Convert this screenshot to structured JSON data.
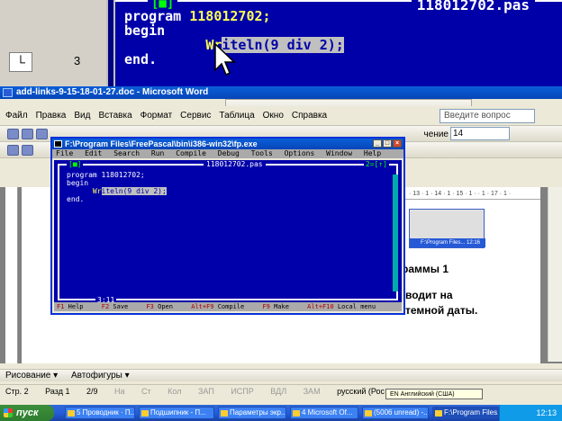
{
  "zoom": {
    "bracket": "[■]",
    "filename": "118012702.pas",
    "ruler_num": "3",
    "line1_kw": "program ",
    "line1_id": "118012702;",
    "line2": "begin",
    "line3_pre": "Wr",
    "line3_sel": "iteln(9 div 2);",
    "line4": "end."
  },
  "word": {
    "title": "add-links-9-15-18-01-27.doc - Microsoft Word",
    "menu": [
      "Файл",
      "Правка",
      "Вид",
      "Вставка",
      "Формат",
      "Сервис",
      "Таблица",
      "Окно",
      "Справка"
    ],
    "help_placeholder": "Введите вопрос",
    "zoom_value": "14",
    "style_label": "чение",
    "ruler": "· 13 · 1 · 14 · 1 · 15 · 1 ·  · 1 · 17 · 1 ·",
    "text1": "раммы 1",
    "text2": "водит на",
    "text3": "темной даты.",
    "mini_task": "F:\\Program Files...  12:16",
    "draw": {
      "draw_label": "Рисование ▾",
      "autoshapes": "Автофигуры ▾"
    },
    "status": {
      "page": "Стр. 2",
      "section": "Разд 1",
      "pages": "2/9",
      "at": "На",
      "line": "Ст",
      "col": "Кол",
      "rec": "ЗАП",
      "trk": "ИСПР",
      "ext": "ВДЛ",
      "ovr": "ЗАМ",
      "lang": "русский (Рос",
      "lang_popup": "EN Английский (США)"
    }
  },
  "fp": {
    "title": "F:\\Program Files\\FreePascal\\bin\\i386-win32\\fp.exe",
    "menu": [
      "File",
      "Edit",
      "Search",
      "Run",
      "Compile",
      "Debug",
      "Tools",
      "Options",
      "Window",
      "Help"
    ],
    "bracket_left": "[■]",
    "filename": "118012702.pas",
    "bracket_right": "2=[↑]",
    "code_line1": "program 118012702;",
    "code_line2": "begin",
    "code_line3_pre": "      Wr",
    "code_line3_sel": "iteln(9 div 2);",
    "code_line4": "end.",
    "cursor_pos": "3:11",
    "status": [
      {
        "key": "F1",
        "label": " Help"
      },
      {
        "key": "F2",
        "label": " Save"
      },
      {
        "key": "F3",
        "label": " Open"
      },
      {
        "key": "Alt+F9",
        "label": " Compile"
      },
      {
        "key": "F9",
        "label": " Make"
      },
      {
        "key": "Alt+F10",
        "label": " Local menu"
      }
    ]
  },
  "taskbar": {
    "start": "пуск",
    "tasks": [
      "5 Проводник · П...",
      "Подшипник - П...",
      "Параметры экр...",
      "4 Microsoft Of...",
      "(5006 unread) -...",
      "F:\\Program Files..."
    ],
    "clock": "12:13"
  }
}
